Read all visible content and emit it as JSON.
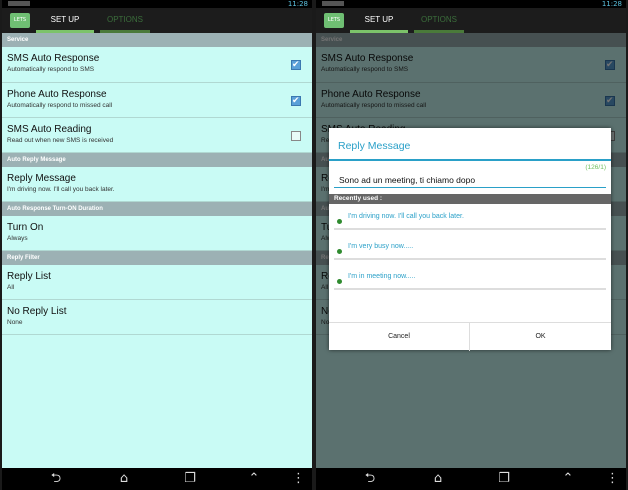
{
  "status": {
    "time": "11:28"
  },
  "tabs": {
    "setup": "SET UP",
    "options": "OPTIONS"
  },
  "app_icon_label": "LETS",
  "sections": {
    "service": "Service",
    "auto_reply": "Auto Reply Message",
    "duration": "Auto Response Turn-ON Duration",
    "filter": "Reply Filter"
  },
  "items": {
    "sms": {
      "title": "SMS Auto Response",
      "subtitle": "Automatically respond to SMS",
      "checked": true
    },
    "phone": {
      "title": "Phone Auto Response",
      "subtitle": "Automatically respond to missed call",
      "checked": true
    },
    "reading": {
      "title": "SMS Auto Reading",
      "subtitle": "Read out when new SMS is received",
      "checked": false
    },
    "reply_message": {
      "title": "Reply Message",
      "subtitle": "I'm driving now. I'll call you back later."
    },
    "turn_on": {
      "title": "Turn On",
      "subtitle": "Always"
    },
    "reply_list": {
      "title": "Reply List",
      "subtitle": "All"
    },
    "no_reply_list": {
      "title": "No Reply List",
      "subtitle": "None"
    }
  },
  "dialog": {
    "title": "Reply Message",
    "counter": "(126/1)",
    "input_value": "Sono ad un meeting, ti chiamo dopo",
    "recent_header": "Recently used :",
    "recent": [
      "I'm driving now. I'll call you back later.",
      "I'm very busy now.....",
      "I'm in meeting now....."
    ],
    "cancel": "Cancel",
    "ok": "OK"
  },
  "nav_icons": [
    "back-icon",
    "home-icon",
    "recent-apps-icon",
    "menu-up-icon",
    "overflow-icon"
  ],
  "colors": {
    "background": "#c9fbf5",
    "accent": "#2aa0c8",
    "tab_indicator": "#7cc36a",
    "section": "#9cb1b4"
  }
}
